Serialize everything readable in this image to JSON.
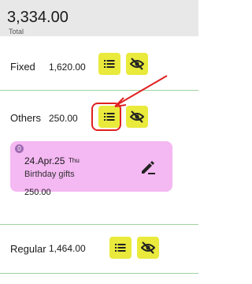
{
  "header": {
    "total": "3,334.00",
    "total_label": "Total"
  },
  "rows": [
    {
      "name": "Fixed",
      "amount": "1,620.00"
    },
    {
      "name": "Others",
      "amount": "250.00"
    },
    {
      "name": "Regular",
      "amount": "1,464.00"
    }
  ],
  "expanded_card": {
    "badge": "0",
    "date": "24.Apr.25",
    "day": "Thu",
    "description": "Birthday gifts",
    "amount": "250.00"
  },
  "icons": {
    "list": "list-icon",
    "hide": "eye-off-icon",
    "edit": "edit-pencil-icon"
  },
  "colors": {
    "button_bg": "#e9ea3c",
    "card_bg": "#f4b8f2",
    "annotation": "#e02020",
    "divider": "#9fd39f"
  }
}
